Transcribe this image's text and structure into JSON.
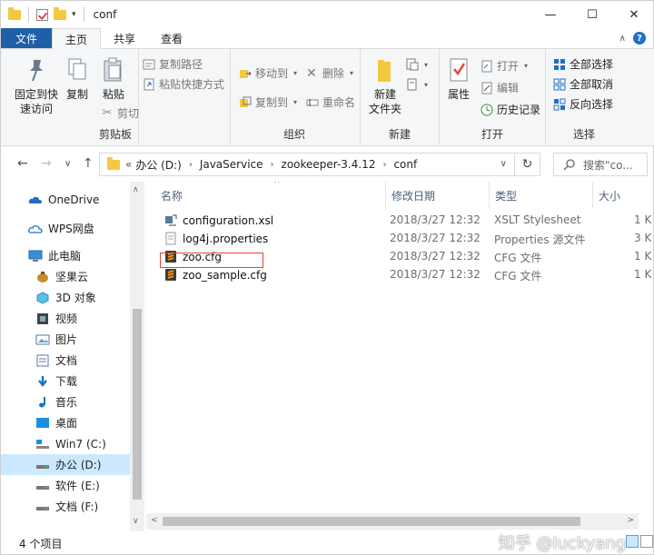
{
  "titlebar": {
    "title": "conf",
    "qa_dropdown": "▾",
    "min": "—",
    "max": "☐",
    "close": "✕"
  },
  "tabs": {
    "file": "文件",
    "home": "主页",
    "share": "共享",
    "view": "查看",
    "collapse": "∧",
    "help": "?"
  },
  "ribbon": {
    "clipboard": {
      "label": "剪贴板",
      "pin": "固定到快速访问",
      "pin_l1": "固定到快",
      "pin_l2": "速访问",
      "copy": "复制",
      "paste": "粘贴",
      "copy_path": "复制路径",
      "paste_shortcut": "粘贴快捷方式",
      "cut": "剪切"
    },
    "organize": {
      "label": "组织",
      "move_to": "移动到",
      "copy_to": "复制到",
      "delete": "删除",
      "rename": "重命名"
    },
    "new": {
      "label": "新建",
      "new_folder_l1": "新建",
      "new_folder_l2": "文件夹"
    },
    "open": {
      "label": "打开",
      "properties": "属性",
      "open": "打开",
      "edit": "编辑",
      "history": "历史记录"
    },
    "select": {
      "label": "选择",
      "select_all": "全部选择",
      "select_none": "全部取消",
      "invert": "反向选择"
    }
  },
  "address": {
    "back": "←",
    "forward": "→",
    "recent": "∨",
    "up": "↑",
    "overflow": "«",
    "crumbs": [
      "办公 (D:)",
      "JavaService",
      "zookeeper-3.4.12",
      "conf"
    ],
    "sep": "›",
    "dropdown": "∨",
    "refresh": "↻",
    "search_placeholder": "搜索\"co..."
  },
  "nav": {
    "items": [
      {
        "label": "OneDrive"
      },
      {
        "label": "WPS网盘"
      },
      {
        "label": "此电脑"
      },
      {
        "label": "坚果云"
      },
      {
        "label": "3D 对象"
      },
      {
        "label": "视频"
      },
      {
        "label": "图片"
      },
      {
        "label": "文档"
      },
      {
        "label": "下载"
      },
      {
        "label": "音乐"
      },
      {
        "label": "桌面"
      },
      {
        "label": "Win7 (C:)"
      },
      {
        "label": "办公 (D:)"
      },
      {
        "label": "软件 (E:)"
      },
      {
        "label": "文档 (F:)"
      }
    ]
  },
  "list": {
    "columns": {
      "name": "名称",
      "date": "修改日期",
      "type": "类型",
      "size": "大小"
    },
    "sort_arrow": "^",
    "rows": [
      {
        "name": "configuration.xsl",
        "date": "2018/3/27 12:32",
        "type": "XSLT Stylesheet",
        "size": "1 K"
      },
      {
        "name": "log4j.properties",
        "date": "2018/3/27 12:32",
        "type": "Properties 源文件",
        "size": "3 K"
      },
      {
        "name": "zoo.cfg",
        "date": "2018/3/27 12:32",
        "type": "CFG 文件",
        "size": "1 K"
      },
      {
        "name": "zoo_sample.cfg",
        "date": "2018/3/27 12:32",
        "type": "CFG 文件",
        "size": "1 K"
      }
    ]
  },
  "scroll": {
    "up": "∧",
    "down": "∨",
    "left": "<",
    "right": ">"
  },
  "status": {
    "count": "4 个项目",
    "watermark": "知乎 @luckyang"
  },
  "colors": {
    "accent": "#1e5fa8",
    "selection": "#cce8ff",
    "highlight_box": "#e0463c",
    "folder": "#f5c842"
  }
}
